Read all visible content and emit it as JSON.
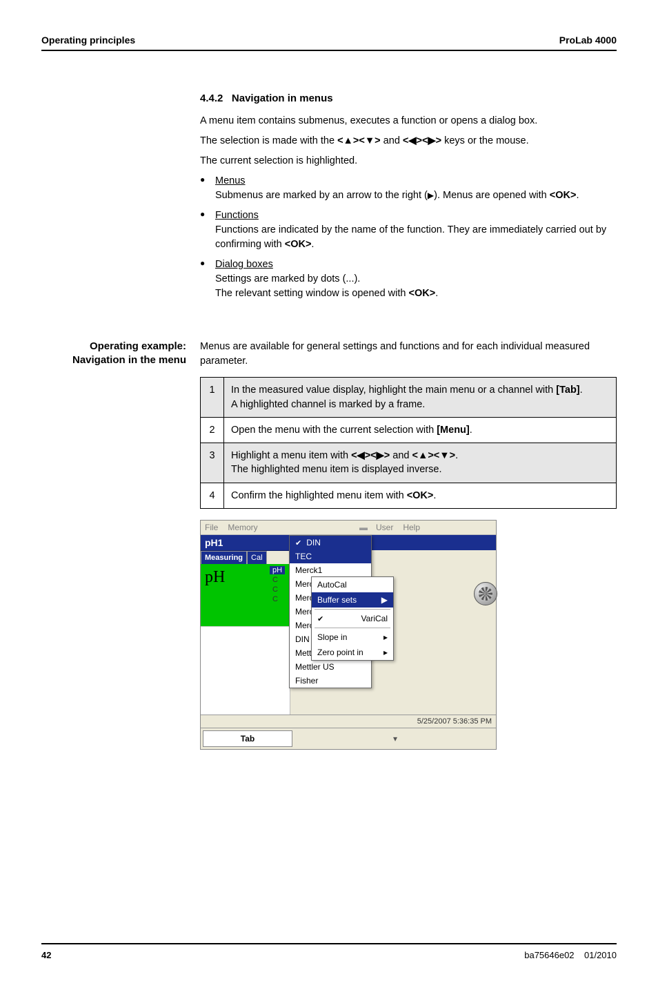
{
  "header": {
    "left": "Operating principles",
    "right": "ProLab 4000"
  },
  "section": {
    "number": "4.4.2",
    "title": "Navigation in menus",
    "p1": "A menu item contains submenus, executes a function or opens a dialog box.",
    "p2a": "The selection is made with the ",
    "p2_keys1": "<▲><▼>",
    "p2_mid": " and ",
    "p2_keys2": "<◀><▶>",
    "p2b": " keys or the mouse.",
    "p3": "The current selection is highlighted."
  },
  "bullets": [
    {
      "title": "Menus",
      "line1a": "Submenus are marked by an arrow to the right (",
      "line1_arrow": "▶",
      "line1b": "). Menus are opened with ",
      "line1_key": "<OK>",
      "line1c": "."
    },
    {
      "title": "Functions",
      "line1a": "Functions are indicated by the name of the function. They are immediately carried out by confirming with ",
      "line1_key": "<OK>",
      "line1b": "."
    },
    {
      "title": "Dialog boxes",
      "line1": "Settings are marked by dots (...).",
      "line2a": "The relevant setting window is opened with ",
      "line2_key": "<OK>",
      "line2b": "."
    }
  ],
  "sidebar": {
    "l1": "Operating example:",
    "l2": "Navigation in the menu"
  },
  "intro2": "Menus are available for general settings and functions and for each individual measured parameter.",
  "steps": [
    {
      "n": "1",
      "pre": "In the measured value display, highlight the main menu or a channel with ",
      "key": "[Tab]",
      "post": ".",
      "extra": "A highlighted channel is marked by a frame."
    },
    {
      "n": "2",
      "pre": "Open the menu with the current selection with ",
      "key": "[Menu]",
      "post": "."
    },
    {
      "n": "3",
      "pre": "Highlight a menu item with ",
      "key1": "<◀><▶>",
      "mid": " and ",
      "key2": "<▲><▼>",
      "post": ".",
      "extra": "The highlighted menu item is displayed inverse."
    },
    {
      "n": "4",
      "pre": "Confirm the highlighted menu item with ",
      "key": "<OK>",
      "post": "."
    }
  ],
  "app": {
    "menubar_left": [
      "File",
      "Memory"
    ],
    "menubar_right": [
      "User",
      "Help"
    ],
    "ph1": "pH1",
    "tabs": {
      "measuring": "Measuring",
      "cal": "Cal"
    },
    "green_label": "pH",
    "mini": [
      "pH",
      "C",
      "C",
      "C"
    ],
    "dropdown": [
      "DIN",
      "TEC",
      "Merck1",
      "Merck2",
      "Merck3",
      "Merck4",
      "Merck5",
      "DIN 19267",
      "Mettler EU",
      "Mettler US",
      "Fisher"
    ],
    "submenu": {
      "autocal": "AutoCal",
      "buffer": "Buffer sets",
      "varical": "VariCal",
      "slope": "Slope in",
      "zero": "Zero point in"
    },
    "timestamp": "5/25/2007 5:36:35 PM",
    "tab_btn": "Tab"
  },
  "footer": {
    "page": "42",
    "doc": "ba75646e02",
    "date": "01/2010"
  }
}
